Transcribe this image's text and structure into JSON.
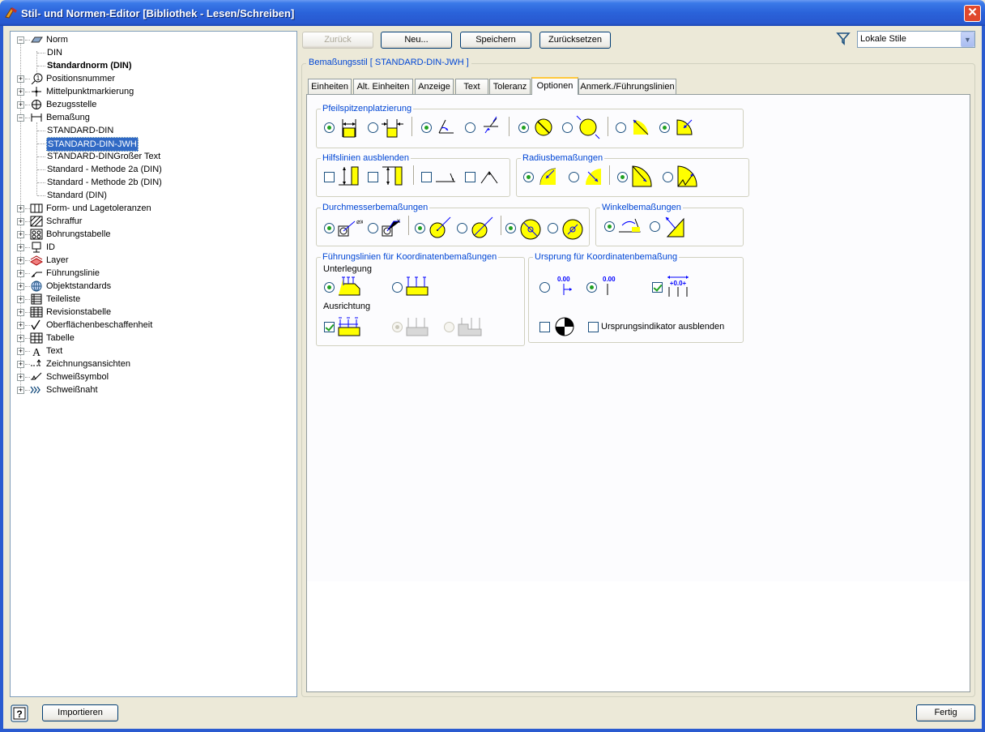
{
  "window": {
    "title": "Stil- und Normen-Editor [Bibliothek - Lesen/Schreiben]"
  },
  "tree": {
    "items": [
      {
        "label": "Norm",
        "icon": "norm-icon",
        "expander": "−",
        "bold": false
      },
      {
        "label": "DIN",
        "icon": "",
        "expander": "",
        "bold": false
      },
      {
        "label": "Standardnorm (DIN)",
        "icon": "",
        "expander": "",
        "bold": true
      },
      {
        "label": "Positionsnummer",
        "icon": "balloon-icon",
        "expander": "+",
        "bold": false
      },
      {
        "label": "Mittelpunktmarkierung",
        "icon": "centermark-icon",
        "expander": "+",
        "bold": false
      },
      {
        "label": "Bezugsstelle",
        "icon": "datum-icon",
        "expander": "+",
        "bold": false
      },
      {
        "label": "Bemaßung",
        "icon": "dimension-icon",
        "expander": "−",
        "bold": false
      },
      {
        "label": "STANDARD-DIN",
        "icon": "",
        "expander": "",
        "bold": false
      },
      {
        "label": "STANDARD-DIN-JWH",
        "icon": "",
        "expander": "",
        "bold": false,
        "selected": true
      },
      {
        "label": "STANDARD-DINGroßer Text",
        "icon": "",
        "expander": "",
        "bold": false
      },
      {
        "label": "Standard - Methode 2a (DIN)",
        "icon": "",
        "expander": "",
        "bold": false
      },
      {
        "label": "Standard - Methode 2b (DIN)",
        "icon": "",
        "expander": "",
        "bold": false
      },
      {
        "label": "Standard (DIN)",
        "icon": "",
        "expander": "",
        "bold": false
      },
      {
        "label": "Form- und Lagetoleranzen",
        "icon": "tolerance-icon",
        "expander": "+",
        "bold": false
      },
      {
        "label": "Schraffur",
        "icon": "hatch-icon",
        "expander": "+",
        "bold": false
      },
      {
        "label": "Bohrungstabelle",
        "icon": "holetable-icon",
        "expander": "+",
        "bold": false
      },
      {
        "label": "ID",
        "icon": "id-icon",
        "expander": "+",
        "bold": false
      },
      {
        "label": "Layer",
        "icon": "layer-icon",
        "expander": "+",
        "bold": false
      },
      {
        "label": "Führungslinie",
        "icon": "leader-icon",
        "expander": "+",
        "bold": false
      },
      {
        "label": "Objektstandards",
        "icon": "globe-icon",
        "expander": "+",
        "bold": false
      },
      {
        "label": "Teileliste",
        "icon": "partslist-icon",
        "expander": "+",
        "bold": false
      },
      {
        "label": "Revisionstabelle",
        "icon": "revtable-icon",
        "expander": "+",
        "bold": false
      },
      {
        "label": "Oberflächenbeschaffenheit",
        "icon": "surface-icon",
        "expander": "+",
        "bold": false
      },
      {
        "label": "Tabelle",
        "icon": "table-icon",
        "expander": "+",
        "bold": false
      },
      {
        "label": "Text",
        "icon": "text-icon",
        "expander": "+",
        "bold": false
      },
      {
        "label": "Zeichnungsansichten",
        "icon": "views-icon",
        "expander": "+",
        "bold": false
      },
      {
        "label": "Schweißsymbol",
        "icon": "weldsymbol-icon",
        "expander": "+",
        "bold": false
      },
      {
        "label": "Schweißnaht",
        "icon": "weldbead-icon",
        "expander": "+",
        "bold": false
      }
    ]
  },
  "toolbar": {
    "back": "Zurück",
    "new": "Neu...",
    "save": "Speichern",
    "reset": "Zurücksetzen",
    "filter_value": "Lokale Stile"
  },
  "style": {
    "group_title": "Bemaßungsstil [ STANDARD-DIN-JWH ]"
  },
  "tabs": [
    {
      "label": "Einheiten"
    },
    {
      "label": "Alt. Einheiten"
    },
    {
      "label": "Anzeige"
    },
    {
      "label": "Text"
    },
    {
      "label": "Toleranz"
    },
    {
      "label": "Optionen",
      "active": true
    },
    {
      "label": "Anmerk./Führungslinien"
    }
  ],
  "options": {
    "arrow_placement": "Pfeilspitzenplatzierung",
    "hide_ext_lines": "Hilfslinien ausblenden",
    "radius_dims": "Radiusbemaßungen",
    "diameter_dims": "Durchmesserbemaßungen",
    "angle_dims": "Winkelbemaßungen",
    "ordinate_leaders": "Führungslinien für Koordinatenbemaßungen",
    "underlay": "Unterlegung",
    "alignment": "Ausrichtung",
    "ordinate_origin": "Ursprung für Koordinatenbemaßung",
    "origin_value": "0.00",
    "origin_value2": "+0.0+",
    "hide_origin_indicator": "Ursprungsindikator ausblenden"
  },
  "footer": {
    "import": "Importieren",
    "done": "Fertig"
  },
  "colors": {
    "accent": "#0046d5",
    "selection": "#316ac5",
    "symbol_fill": "#ffff00",
    "arrow": "#0000ff"
  }
}
